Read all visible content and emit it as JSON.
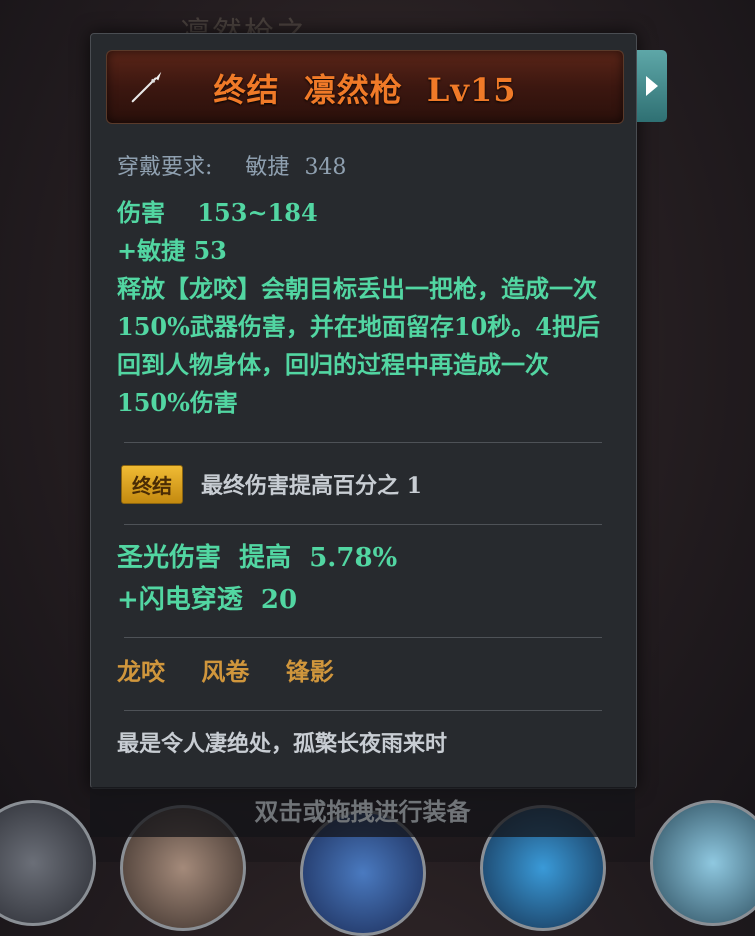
{
  "header": {
    "quality": "终结",
    "item_name": "凛然枪",
    "level": "Lv15",
    "icon": "spear-icon"
  },
  "requirement": {
    "label": "穿戴要求:",
    "stat": "敏捷",
    "value": "348"
  },
  "stats": {
    "damage_label": "伤害",
    "damage_value": "153~184",
    "agility_bonus": "+敏捷 53",
    "skill_desc": "释放【龙咬】会朝目标丢出一把枪，造成一次150%武器伤害，并在地面留存10秒。4把后回到人物身体，回归的过程中再造成一次150%伤害"
  },
  "affix": {
    "badge": "终结",
    "text": "最终伤害提高百分之 1"
  },
  "bonuses": {
    "holy": "圣光伤害  提高  5.78%",
    "lightning": "+闪电穿透  20"
  },
  "skills": [
    "龙咬",
    "风卷",
    "锋影"
  ],
  "flavor_text": "最是令人凄绝处，孤檠长夜雨来时",
  "footer_hint": "双击或拖拽进行装备",
  "background_title": "凛然枪之",
  "colors": {
    "title": "#f07a28",
    "stat_green": "#52d6a2",
    "badge_gold": "#f0bb34",
    "skill_orange": "#d0963c"
  }
}
